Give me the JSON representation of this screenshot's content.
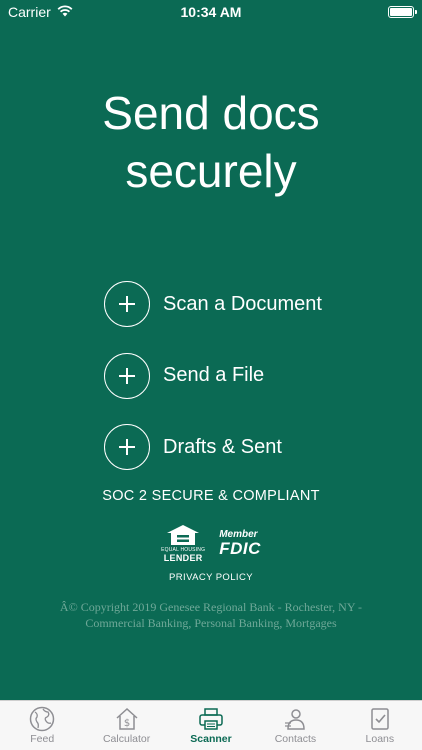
{
  "status_bar": {
    "carrier": "Carrier",
    "time": "10:34 AM"
  },
  "headline": {
    "line1": "Send docs",
    "line2": "securely"
  },
  "actions": [
    {
      "label": "Scan a Document"
    },
    {
      "label": "Send a File"
    },
    {
      "label": "Drafts & Sent"
    }
  ],
  "compliance": {
    "soc": "SOC 2 SECURE & COMPLIANT"
  },
  "logos": {
    "ehl_small": "EQUAL HOUSING",
    "ehl_big": "LENDER",
    "fdic_member": "Member",
    "fdic_name": "FDIC"
  },
  "footer": {
    "privacy": "PRIVACY POLICY",
    "copyright_line1": "Â© Copyright 2019 Genesee Regional Bank - Rochester, NY -",
    "copyright_line2": "Commercial Banking, Personal Banking, Mortgages"
  },
  "tabs": [
    {
      "label": "Feed",
      "icon": "globe-icon"
    },
    {
      "label": "Calculator",
      "icon": "house-dollar-icon"
    },
    {
      "label": "Scanner",
      "icon": "scanner-icon",
      "active": true
    },
    {
      "label": "Contacts",
      "icon": "contacts-icon"
    },
    {
      "label": "Loans",
      "icon": "clipboard-check-icon"
    }
  ],
  "colors": {
    "background": "#0b6a54",
    "tab_bar": "#f7f7f7",
    "tab_inactive": "#8e8e93",
    "copyright": "#6fa898"
  }
}
